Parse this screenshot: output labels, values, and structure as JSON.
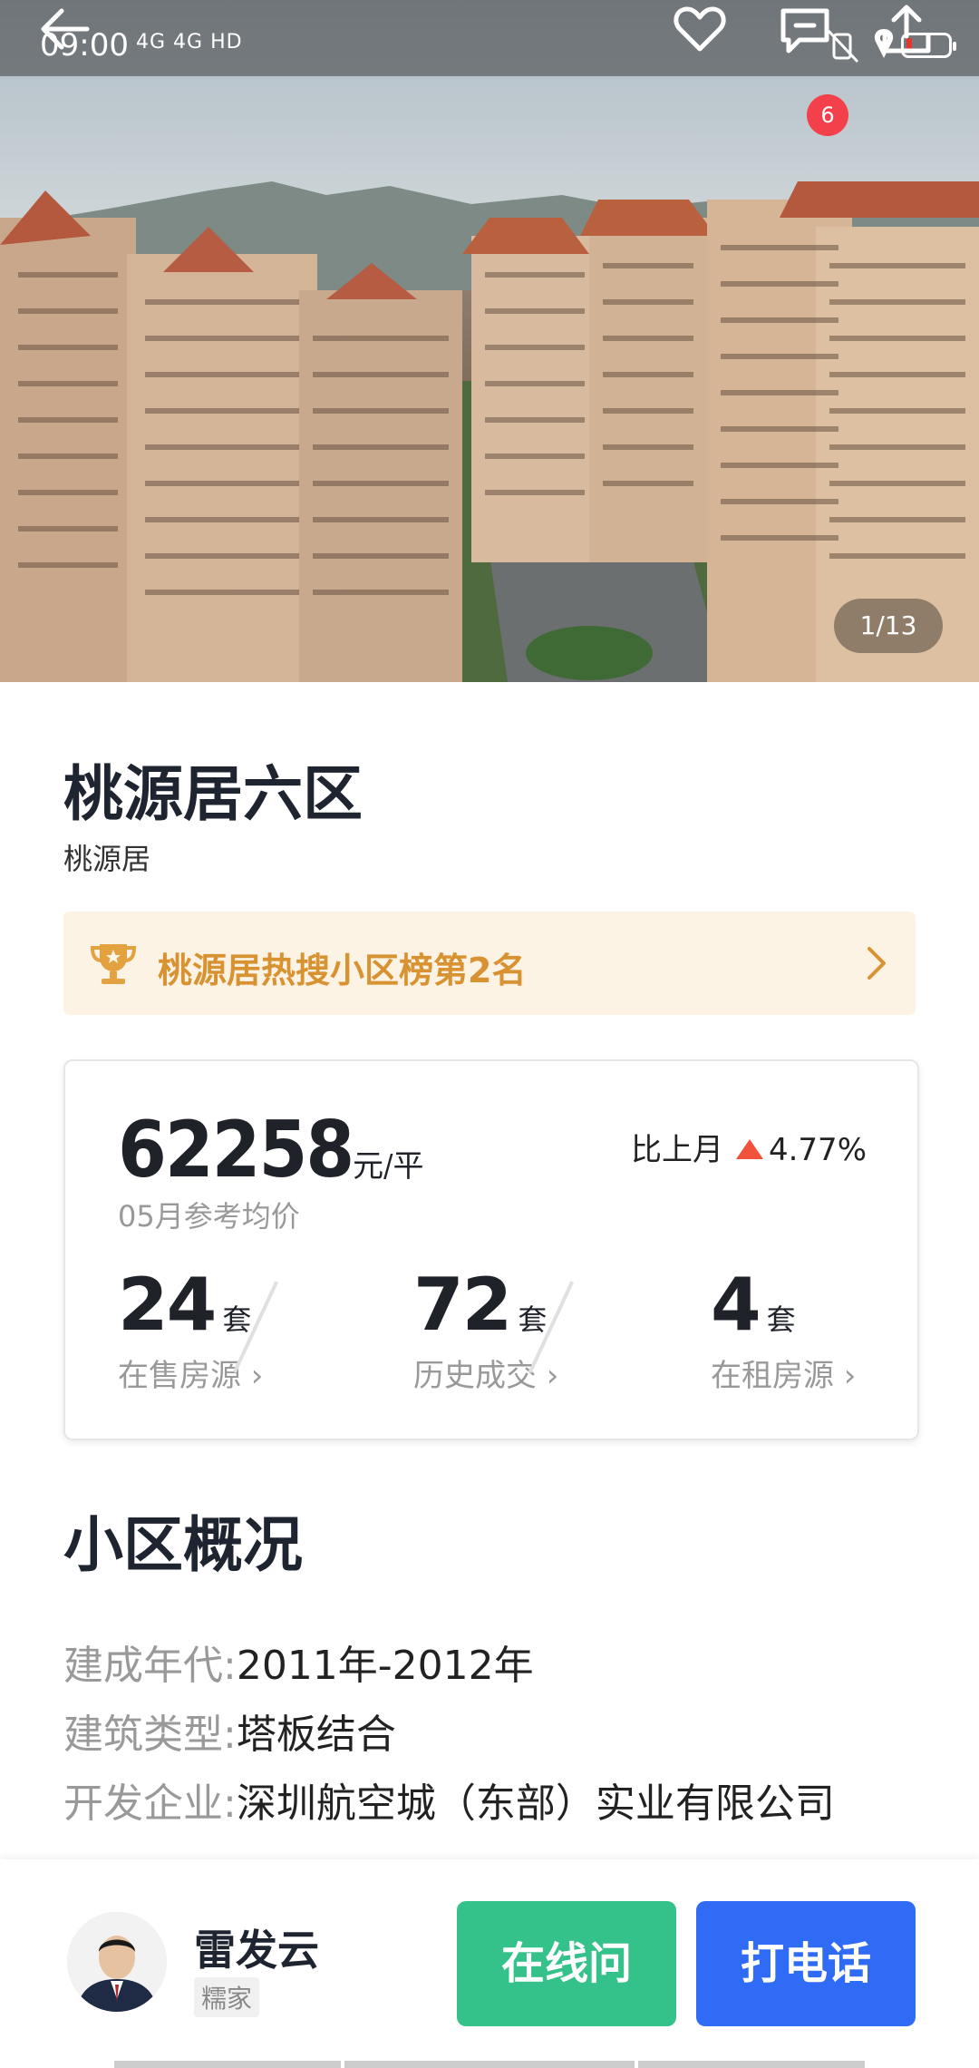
{
  "status_bar": {
    "time": "09:00",
    "network": "4G 4G HD"
  },
  "header": {
    "message_badge": "6",
    "photo_counter": "1/13"
  },
  "community": {
    "name": "桃源居六区",
    "area": "桃源居",
    "rank_text": "桃源居热搜小区榜第2名"
  },
  "price_card": {
    "price": "62258",
    "price_unit": "元/平",
    "price_caption": "05月参考均价",
    "mom_label": "比上月",
    "mom_value": "4.77%",
    "stats": [
      {
        "value": "24",
        "unit": "套",
        "label": "在售房源 ›"
      },
      {
        "value": "72",
        "unit": "套",
        "label": "历史成交 ›"
      },
      {
        "value": "4",
        "unit": "套",
        "label": "在租房源 ›"
      }
    ]
  },
  "overview": {
    "title": "小区概况",
    "rows": [
      {
        "key": "建成年代:",
        "value": "2011年-2012年"
      },
      {
        "key": "建筑类型:",
        "value": "塔板结合"
      },
      {
        "key": "开发企业:",
        "value": "深圳航空城（东部）实业有限公司"
      }
    ]
  },
  "agent": {
    "name": "雷发云",
    "tag": "糯家",
    "online_button": "在线问",
    "call_button": "打电话"
  },
  "colors": {
    "accent_orange": "#d89231",
    "rank_bg": "#fdf3e4",
    "up_red": "#f0523c",
    "green_button": "#35c28a",
    "blue_button": "#2f6bf5",
    "badge_red": "#f4404a"
  }
}
